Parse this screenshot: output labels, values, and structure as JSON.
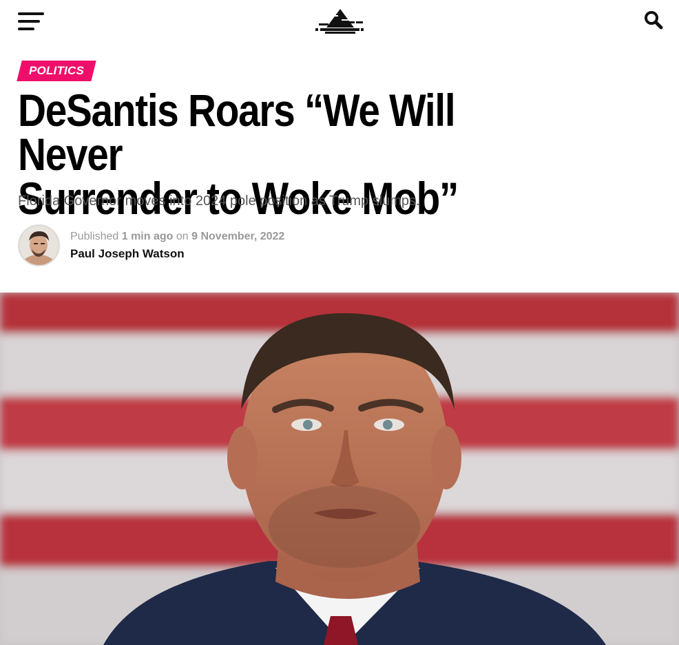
{
  "header": {
    "menu_icon": "hamburger-menu-icon",
    "logo_icon": "site-logo-icon",
    "search_icon": "search-icon"
  },
  "article": {
    "category": "POLITICS",
    "headline_line1": "DeSantis Roars “We Will Never",
    "headline_line2": "Surrender to Woke Mob”",
    "subtitle": "Florida Governor moves into 2024 pole position as Trump slumps.",
    "byline": {
      "published_label": "Published",
      "relative_time": "1 min ago",
      "on_label": "on",
      "date": "9 November, 2022",
      "author": "Paul Joseph Watson"
    }
  },
  "colors": {
    "category_badge": "#ef0f6a",
    "text": "#111111",
    "meta": "#999999"
  }
}
